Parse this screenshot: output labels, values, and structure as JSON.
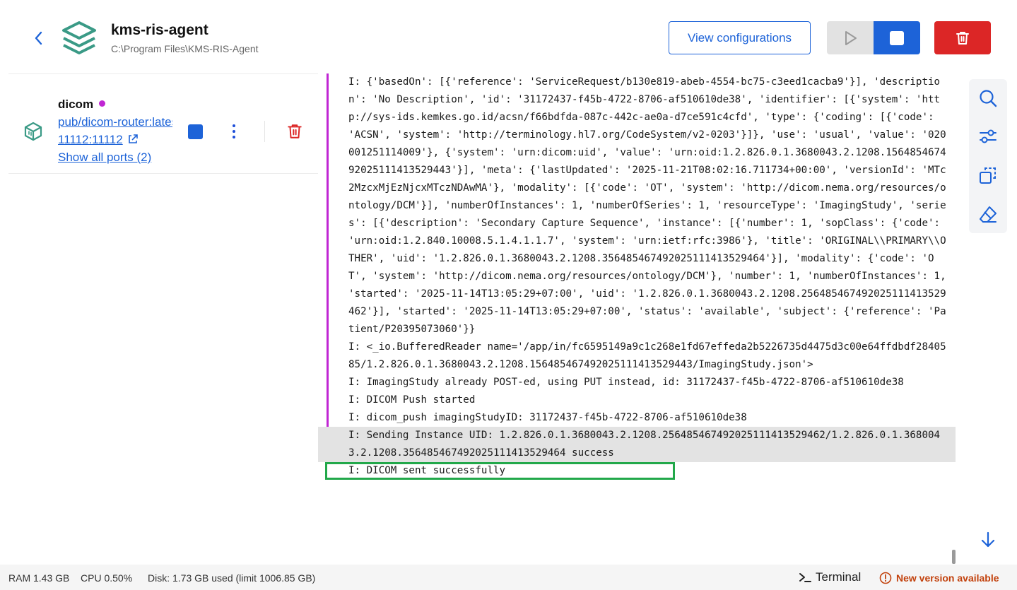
{
  "header": {
    "title": "kms-ris-agent",
    "path": "C:\\Program Files\\KMS-RIS-Agent",
    "view_config_label": "View configurations",
    "logo_icon": "layers-stack-icon",
    "brand_color": "#3a9a86"
  },
  "container": {
    "name": "dicom",
    "status_color": "#c026d3",
    "image": "pub/dicom-router:latest",
    "port": "11112:11112",
    "ports_label": "Show all ports (2)"
  },
  "logs": [
    {
      "text": "I: {'basedOn': [{'reference': 'ServiceRequest/b130e819-abeb-4554-bc75-c3eed1cacba9'}], 'description': 'No Description', 'id': '31172437-f45b-4722-8706-af510610de38', 'identifier': [{'system': 'http://sys-ids.kemkes.go.id/acsn/f66bdfda-087c-442c-ae0a-d7ce591c4cfd', 'type': {'coding': [{'code': 'ACSN', 'system': 'http://terminology.hl7.org/CodeSystem/v2-0203'}]}, 'use': 'usual', 'value': '020001251114009'}, {'system': 'urn:dicom:uid', 'value': 'urn:oid:1.2.826.0.1.3680043.2.1208.156485467492025111413529443'}], 'meta': {'lastUpdated': '2025-11-21T08:02:16.711734+00:00', 'versionId': 'MTc2MzcxMjEzNjcxMTczNDAwMA'}, 'modality': [{'code': 'OT', 'system': 'http://dicom.nema.org/resources/ontology/DCM'}], 'numberOfInstances': 1, 'numberOfSeries': 1, 'resourceType': 'ImagingStudy', 'series': [{'description': 'Secondary Capture Sequence', 'instance': [{'number': 1, 'sopClass': {'code': 'urn:oid:1.2.840.10008.5.1.4.1.1.7', 'system': 'urn:ietf:rfc:3986'}, 'title': 'ORIGINAL\\\\PRIMARY\\\\OTHER', 'uid': '1.2.826.0.1.3680043.2.1208.356485467492025111413529464'}], 'modality': {'code': 'OT', 'system': 'http://dicom.nema.org/resources/ontology/DCM'}, 'number': 1, 'numberOfInstances': 1, 'started': '2025-11-14T13:05:29+07:00', 'uid': '1.2.826.0.1.3680043.2.1208.256485467492025111413529462'}], 'started': '2025-11-14T13:05:29+07:00', 'status': 'available', 'subject': {'reference': 'Patient/P20395073060'}}",
      "marked": true
    },
    {
      "text": "I: <_io.BufferedReader name='/app/in/fc6595149a9c1c268e1fd67effeda2b5226735d4475d3c00e64ffdbdf2840585/1.2.826.0.1.3680043.2.1208.156485467492025111413529443/ImagingStudy.json'>",
      "marked": true
    },
    {
      "text": "I: ImagingStudy already POST-ed, using PUT instead, id: 31172437-f45b-4722-8706-af510610de38",
      "marked": true
    },
    {
      "text": "I: DICOM Push started",
      "marked": true
    },
    {
      "text": "I: dicom_push imagingStudyID: 31172437-f45b-4722-8706-af510610de38",
      "marked": true
    },
    {
      "text": "I: Sending Instance UID: 1.2.826.0.1.3680043.2.1208.256485467492025111413529462/1.2.826.0.1.3680043.2.1208.356485467492025111413529464 success",
      "marked": false,
      "highlight": true
    },
    {
      "text": "I: DICOM sent successfully",
      "marked": false,
      "boxed": true
    }
  ],
  "toolbar": {
    "search_icon": "search-icon",
    "filter_icon": "sliders-icon",
    "copy_icon": "copy-icon",
    "clear_icon": "eraser-icon",
    "scroll_icon": "arrow-down-icon"
  },
  "footer": {
    "ram": "RAM 1.43 GB",
    "cpu": "CPU 0.50%",
    "disk": "Disk: 1.73 GB used (limit 1006.85 GB)",
    "terminal_label": "Terminal",
    "new_version_label": "New version available"
  },
  "colors": {
    "primary": "#1d63d8",
    "danger": "#dc2626",
    "log_marker": "#c026d3",
    "success_outline": "#22a84a",
    "warning": "#c2410c"
  }
}
